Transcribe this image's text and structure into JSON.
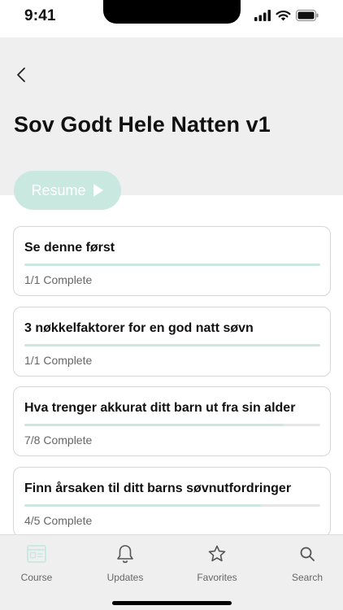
{
  "status_bar": {
    "time": "9:41"
  },
  "header": {
    "title": "Sov Godt Hele Natten v1"
  },
  "resume": {
    "label": "Resume"
  },
  "modules": [
    {
      "title": "Se denne først",
      "progress_text": "1/1 Complete",
      "progress": 1.0
    },
    {
      "title": "3 nøkkelfaktorer for en god natt søvn",
      "progress_text": "1/1 Complete",
      "progress": 1.0
    },
    {
      "title": "Hva trenger akkurat ditt barn ut fra sin alder",
      "progress_text": "7/8 Complete",
      "progress": 0.875
    },
    {
      "title": "Finn årsaken til ditt barns søvnutfordringer",
      "progress_text": "4/5 Complete",
      "progress": 0.8
    }
  ],
  "tab_bar": {
    "tabs": [
      {
        "label": "Course",
        "icon": "course-icon",
        "active": true
      },
      {
        "label": "Updates",
        "icon": "bell-icon",
        "active": false
      },
      {
        "label": "Favorites",
        "icon": "star-icon",
        "active": false
      },
      {
        "label": "Search",
        "icon": "search-icon",
        "active": false
      }
    ]
  },
  "colors": {
    "accent": "#c8e8e0",
    "header_bg": "#efefef"
  }
}
